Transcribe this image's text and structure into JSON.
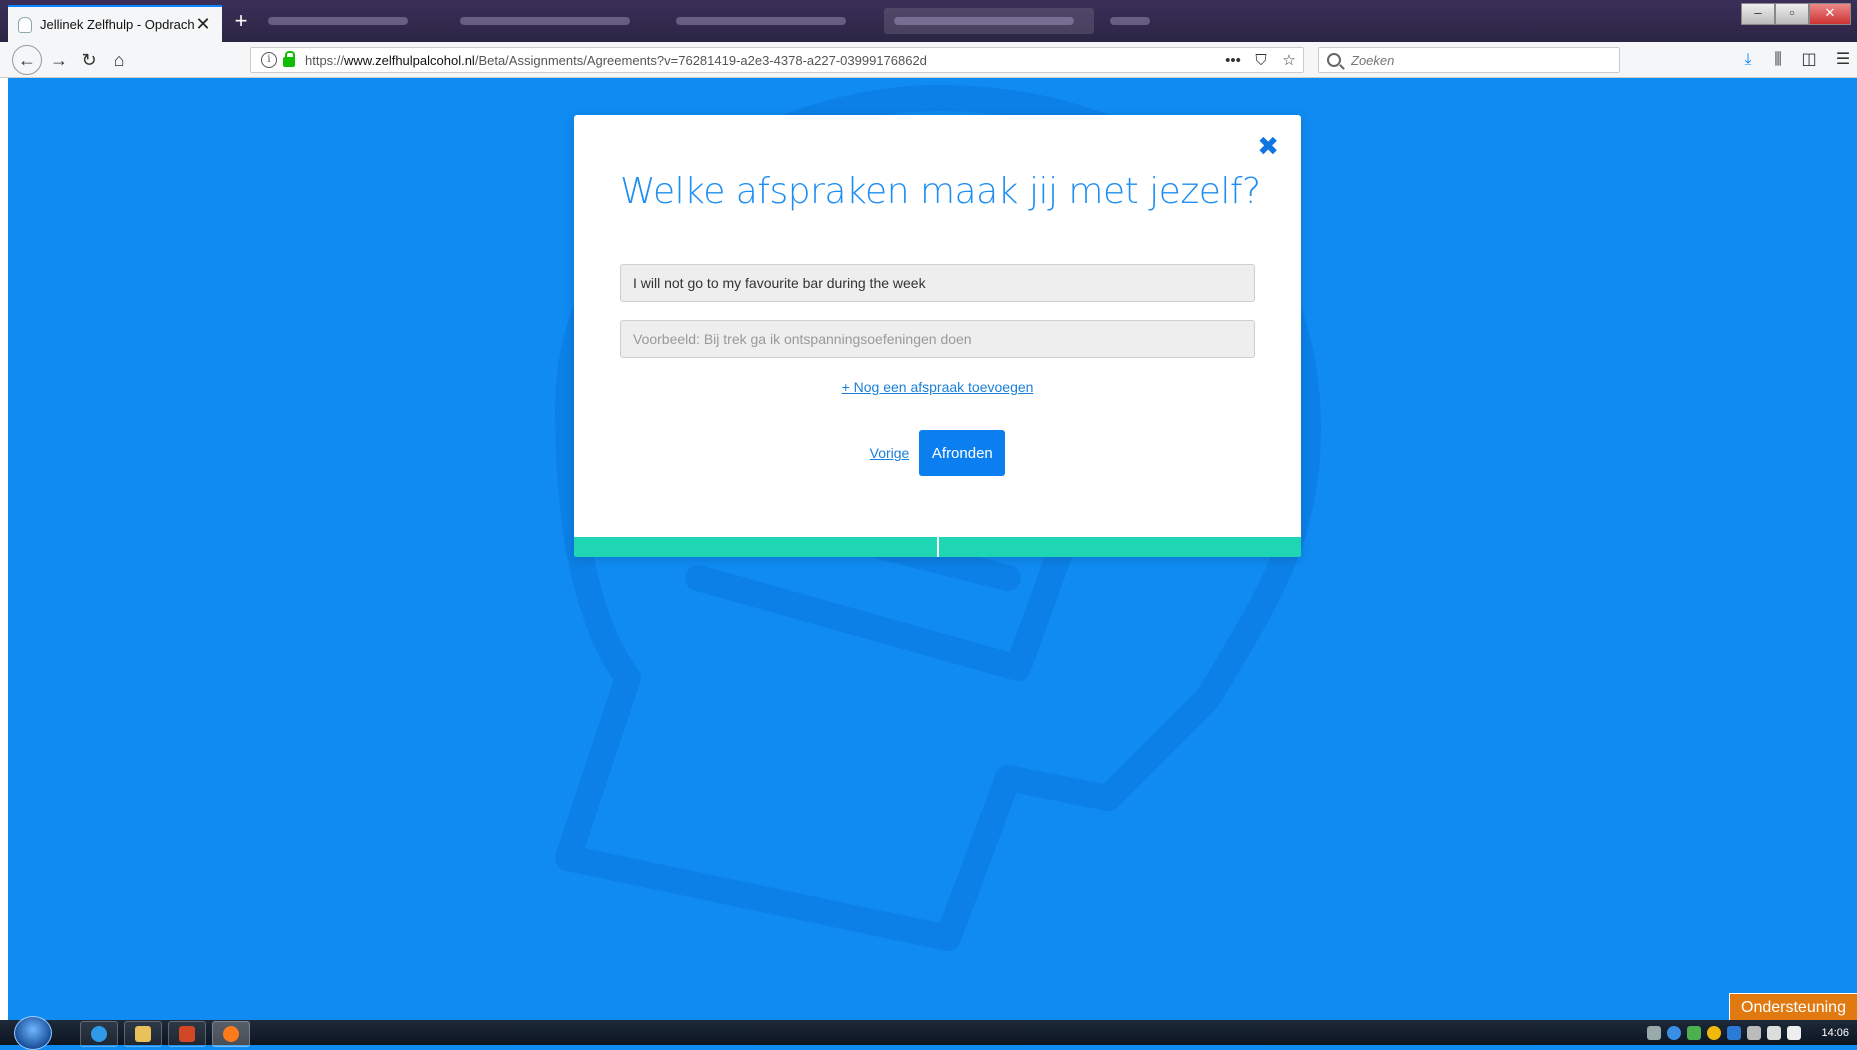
{
  "browser": {
    "active_tab_title": "Jellinek Zelfhulp - Opdracht",
    "new_tab_symbol": "+",
    "url_host": "www.zelfhulpalcohol.nl",
    "url_prefix": "https://",
    "url_path": "/Beta/Assignments/Agreements?v=76281419-a2e3-4378-a227-03999176862d",
    "search_placeholder": "Zoeken",
    "page_actions_icon": "•••"
  },
  "modal": {
    "title": "Welke afspraken maak jij met jezelf?",
    "agreement_1_value": "I will not go to my favourite bar during the week",
    "agreement_2_placeholder": "Voorbeeld: Bij trek ga ik ontspanningsoefeningen doen",
    "add_link": "+ Nog een afspraak toevoegen",
    "prev_label": "Vorige",
    "finish_label": "Afronden",
    "progress_steps": 2,
    "progress_completed": 2
  },
  "support_label": "Ondersteuning",
  "taskbar": {
    "clock": "14:06"
  },
  "colors": {
    "page_background": "#0f8bf2",
    "accent": "#1f8ef1",
    "button": "#0c7ff0",
    "progress": "#1fd6b4",
    "support": "#e07a10"
  }
}
